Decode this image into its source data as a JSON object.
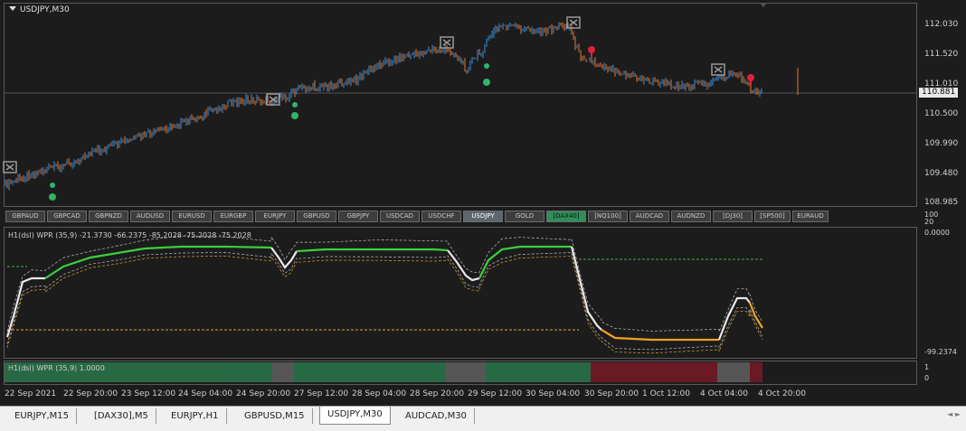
{
  "chart": {
    "title": "USDJPY,M30",
    "current_price": "110.881",
    "price_labels": [
      "112.030",
      "111.520",
      "111.010",
      "110.500",
      "109.990",
      "109.480",
      "108.985"
    ],
    "colors": {
      "background": "#1c1c1c",
      "bull": "#3b8fe0",
      "bear": "#e07a3a",
      "green_dot": "#2fb56a",
      "red_marker": "#e0203a"
    }
  },
  "symbols": [
    {
      "label": "GBPAUD"
    },
    {
      "label": "GBPCAD"
    },
    {
      "label": "GBPNZD"
    },
    {
      "label": "AUDUSD"
    },
    {
      "label": "EURUSD"
    },
    {
      "label": "EURGBP"
    },
    {
      "label": "EURJPY"
    },
    {
      "label": "GBPUSD"
    },
    {
      "label": "GBPJPY"
    },
    {
      "label": "USDCAD"
    },
    {
      "label": "USDCHF"
    },
    {
      "label": "USDJPY",
      "state": "active"
    },
    {
      "label": "GOLD"
    },
    {
      "label": "[DAX40]",
      "state": "green"
    },
    {
      "label": "[NQ100]"
    },
    {
      "label": "AUDCAD"
    },
    {
      "label": "AUDNZD"
    },
    {
      "label": "[DJ30]"
    },
    {
      "label": "[SP500]"
    },
    {
      "label": "EURAUD"
    }
  ],
  "indicator1": {
    "label": "H1(dsl) WPR (35,9) -21.3730 -66.2375 -85.2028 -75.2028 -75.2028",
    "axis_labels": [
      "100",
      "20",
      "0.0000",
      "-99.2374"
    ]
  },
  "indicator2": {
    "label": "H1(dsl) WPR (35,9) 1.0000",
    "axis_labels": [
      "1",
      "0"
    ],
    "colors": {
      "up": "#2e8b57",
      "neutral": "#707070",
      "down": "#8b1a2a"
    }
  },
  "time_axis": [
    "22 Sep 2021",
    "22 Sep 20:00",
    "23 Sep 12:00",
    "24 Sep 04:00",
    "24 Sep 20:00",
    "27 Sep 12:00",
    "28 Sep 04:00",
    "28 Sep 20:00",
    "29 Sep 12:00",
    "30 Sep 04:00",
    "30 Sep 20:00",
    "1 Oct 12:00",
    "4 Oct 04:00",
    "4 Oct 20:00"
  ],
  "tabs": [
    {
      "label": "EURJPY,M15"
    },
    {
      "label": "[DAX30],M5"
    },
    {
      "label": "EURJPY,H1"
    },
    {
      "label": "GBPUSD,M15"
    },
    {
      "label": "USDJPY,M30",
      "active": true
    },
    {
      "label": "AUDCAD,M30"
    }
  ]
}
